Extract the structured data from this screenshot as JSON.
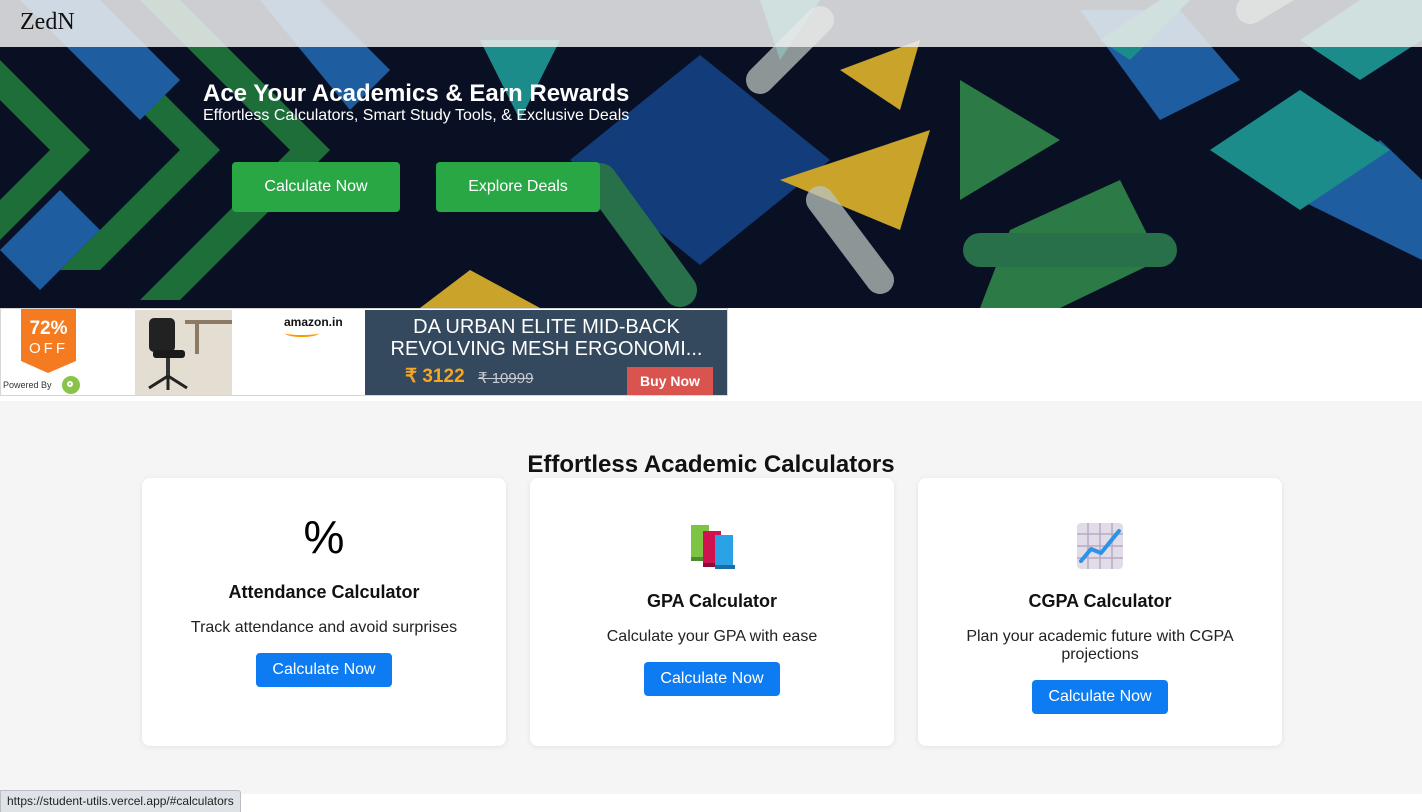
{
  "brand": "ZedN",
  "hero": {
    "title": "Ace Your Academics & Earn Rewards",
    "subtitle": "Effortless Calculators, Smart Study Tools, & Exclusive Deals",
    "primary_button": "Calculate Now",
    "secondary_button": "Explore Deals"
  },
  "ad": {
    "discount_percent": "72%",
    "discount_off": "OFF",
    "powered_by": "Powered By",
    "store": "amazon.in",
    "title": "DA URBAN ELITE MID-BACK\nREVOLVING MESH ERGONOMI...",
    "price": "₹ 3122",
    "original_price": "₹ 10999",
    "buy_button": "Buy Now"
  },
  "calculators": {
    "title": "Effortless Academic Calculators",
    "cards": [
      {
        "icon": "percent-icon",
        "icon_glyph": "%",
        "title": "Attendance Calculator",
        "description": "Track attendance and avoid surprises",
        "button": "Calculate Now"
      },
      {
        "icon": "books-icon",
        "title": "GPA Calculator",
        "description": "Calculate your GPA with ease",
        "button": "Calculate Now"
      },
      {
        "icon": "chart-increasing-icon",
        "title": "CGPA Calculator",
        "description": "Plan your academic future with CGPA projections",
        "button": "Calculate Now"
      }
    ]
  },
  "status_bar": {
    "url": "https://student-utils.vercel.app/#calculators"
  },
  "colors": {
    "hero_background": "#0a1024",
    "green_button": "#2aa745",
    "blue_button": "#0d7bf2",
    "ad_panel": "#34485e",
    "ad_price": "#f5a623",
    "ad_buy": "#d9534f",
    "section_background": "#f5f5f5"
  }
}
